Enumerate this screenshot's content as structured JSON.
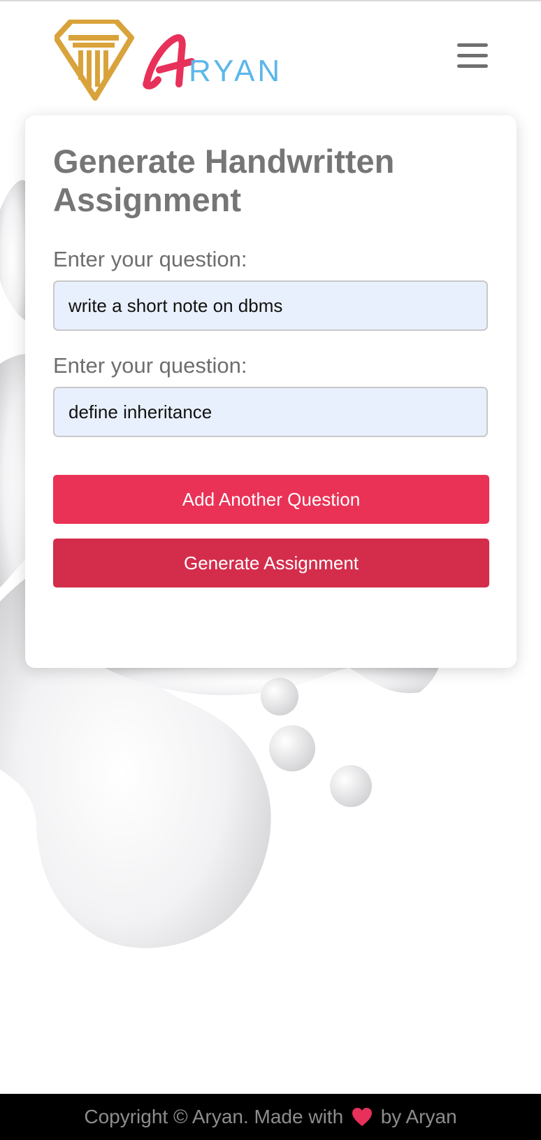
{
  "brand": {
    "logo_text": "ARYAN",
    "accent_red": "#e8315a",
    "accent_blue": "#5cb7ea",
    "accent_gold": "#d9a33b"
  },
  "header": {
    "menu_icon": "hamburger-menu-icon"
  },
  "form": {
    "title": "Generate Handwritten Assignment",
    "questions": [
      {
        "label": "Enter your question:",
        "value": "write a short note on dbms"
      },
      {
        "label": "Enter your question:",
        "value": "define inheritance"
      }
    ],
    "add_button_label": "Add Another Question",
    "generate_button_label": "Generate Assignment"
  },
  "footer": {
    "text_before": "Copyright © Aryan. Made with",
    "heart_icon": "heart-icon",
    "text_after": "by Aryan"
  }
}
